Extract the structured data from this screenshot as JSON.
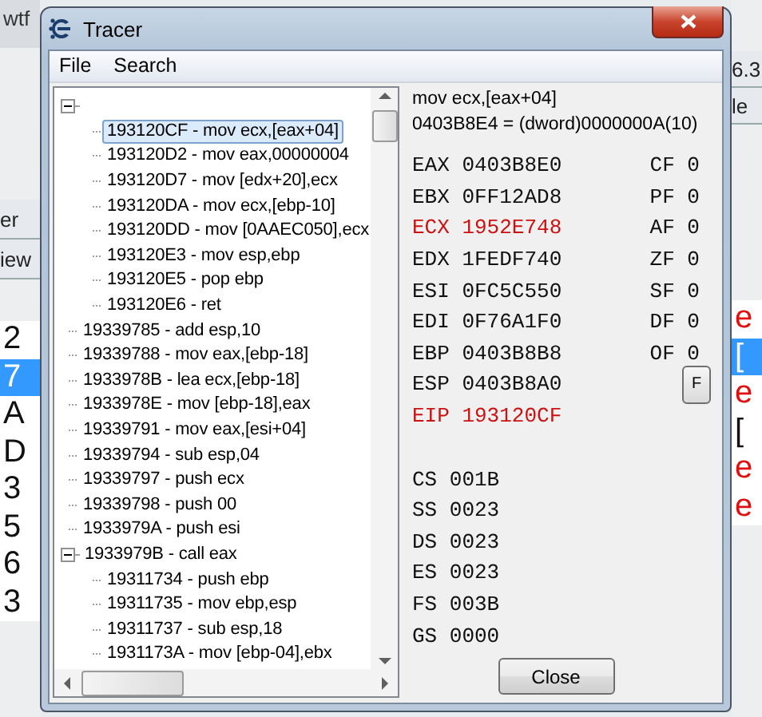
{
  "background_left": {
    "title": "wtf",
    "tabs": [
      "er",
      "iew"
    ],
    "cells": [
      {
        "text": "2",
        "selected": false
      },
      {
        "text": "7",
        "selected": true
      },
      {
        "text": "A",
        "selected": false
      },
      {
        "text": "D",
        "selected": false
      },
      {
        "text": "3",
        "selected": false
      },
      {
        "text": "5",
        "selected": false
      },
      {
        "text": "6",
        "selected": false
      },
      {
        "text": "3",
        "selected": false
      }
    ]
  },
  "background_right": {
    "version": "6.3",
    "header": "le",
    "cells": [
      {
        "text": "e",
        "selected": false
      },
      {
        "text": "[",
        "selected": true
      },
      {
        "text": "e",
        "selected": false
      },
      {
        "text": "[",
        "selected": false
      },
      {
        "text": "e",
        "selected": false
      },
      {
        "text": "e",
        "selected": false
      }
    ]
  },
  "window": {
    "title": "Tracer"
  },
  "menu": [
    "File",
    "Search"
  ],
  "tree": [
    {
      "expanded": true,
      "children": [
        {
          "label": "193120CF - mov ecx,[eax+04]",
          "selected": true
        },
        {
          "label": "193120D2 - mov eax,00000004",
          "selected": false
        },
        {
          "label": "193120D7 - mov [edx+20],ecx",
          "selected": false
        },
        {
          "label": "193120DA - mov ecx,[ebp-10]",
          "selected": false
        },
        {
          "label": "193120DD - mov [0AAEC050],ecx",
          "selected": false
        },
        {
          "label": "193120E3 - mov esp,ebp",
          "selected": false
        },
        {
          "label": "193120E5 - pop ebp",
          "selected": false
        },
        {
          "label": "193120E6 - ret",
          "selected": false
        }
      ]
    },
    {
      "label": "19339785 - add esp,10",
      "selected": false
    },
    {
      "label": "19339788 - mov eax,[ebp-18]",
      "selected": false
    },
    {
      "label": "1933978B - lea ecx,[ebp-18]",
      "selected": false
    },
    {
      "label": "1933978E - mov [ebp-18],eax",
      "selected": false
    },
    {
      "label": "19339791 - mov eax,[esi+04]",
      "selected": false
    },
    {
      "label": "19339794 - sub esp,04",
      "selected": false
    },
    {
      "label": "19339797 - push ecx",
      "selected": false
    },
    {
      "label": "19339798 - push 00",
      "selected": false
    },
    {
      "label": "1933979A - push esi",
      "selected": false
    },
    {
      "label": "1933979B - call eax",
      "expanded": true,
      "selected": false,
      "children": [
        {
          "label": "19311734 - push ebp",
          "selected": false
        },
        {
          "label": "19311735 - mov ebp,esp",
          "selected": false
        },
        {
          "label": "19311737 - sub esp,18",
          "selected": false
        },
        {
          "label": "1931173A - mov [ebp-04],ebx",
          "selected": false
        }
      ]
    }
  ],
  "instruction": "mov ecx,[eax+04]",
  "memory": "0403B8E4 = (dword)0000000A(10)",
  "registers": [
    {
      "name": "EAX",
      "value": "0403B8E0",
      "changed": false
    },
    {
      "name": "EBX",
      "value": "0FF12AD8",
      "changed": false
    },
    {
      "name": "ECX",
      "value": "1952E748",
      "changed": true
    },
    {
      "name": "EDX",
      "value": "1FEDF740",
      "changed": false
    },
    {
      "name": "ESI",
      "value": "0FC5C550",
      "changed": false
    },
    {
      "name": "EDI",
      "value": "0F76A1F0",
      "changed": false
    },
    {
      "name": "EBP",
      "value": "0403B8B8",
      "changed": false
    },
    {
      "name": "ESP",
      "value": "0403B8A0",
      "changed": false
    },
    {
      "name": "EIP",
      "value": "193120CF",
      "changed": true
    }
  ],
  "flags": [
    {
      "name": "CF",
      "value": "0"
    },
    {
      "name": "PF",
      "value": "0"
    },
    {
      "name": "AF",
      "value": "0"
    },
    {
      "name": "ZF",
      "value": "0"
    },
    {
      "name": "SF",
      "value": "0"
    },
    {
      "name": "DF",
      "value": "0"
    },
    {
      "name": "OF",
      "value": "0"
    }
  ],
  "flags_button": "F",
  "segments": [
    {
      "name": "CS",
      "value": "001B"
    },
    {
      "name": "SS",
      "value": "0023"
    },
    {
      "name": "DS",
      "value": "0023"
    },
    {
      "name": "ES",
      "value": "0023"
    },
    {
      "name": "FS",
      "value": "003B"
    },
    {
      "name": "GS",
      "value": "0000"
    }
  ],
  "close_button": "Close"
}
